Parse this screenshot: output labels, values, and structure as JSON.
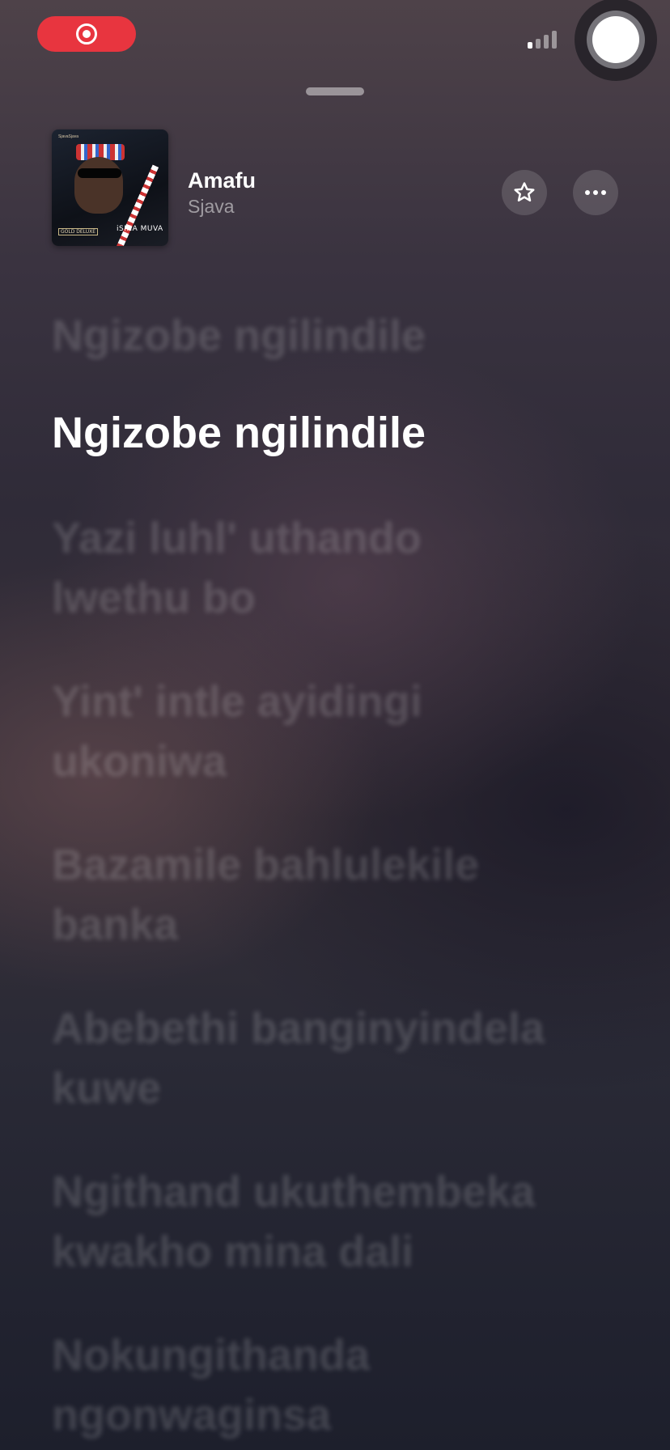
{
  "status_bar": {
    "recording_icon": "screen-record-icon",
    "signal_icon": "cellular-signal-icon",
    "assistive_icon": "assistive-touch-icon"
  },
  "artwork": {
    "top_text": "SjavaSjava",
    "label_left": "GOLD DELUXE",
    "label_right": "iSINA MUVA"
  },
  "now_playing": {
    "title": "Amafu",
    "artist": "Sjava",
    "favorite_icon": "star-icon",
    "more_icon": "ellipsis-icon"
  },
  "lyrics": {
    "previous": [
      "Ngizobe ngilindile"
    ],
    "current": "Ngizobe ngilindile",
    "upcoming": [
      [
        "Yazi luhl' uthando",
        "lwethu bo"
      ],
      [
        "Yint' intle ayidingi",
        "ukoniwa"
      ],
      [
        "Bazamile bahlulekile",
        "banka"
      ],
      [
        "Abebethi banginyindela",
        "kuwe"
      ],
      [
        "Ngithand ukuthembeka",
        "kwakho mina dali"
      ],
      [
        "Nokungithanda",
        "ngonwaginsa"
      ]
    ]
  },
  "colors": {
    "record_pill": "#e8353f",
    "text_primary": "#ffffff"
  }
}
